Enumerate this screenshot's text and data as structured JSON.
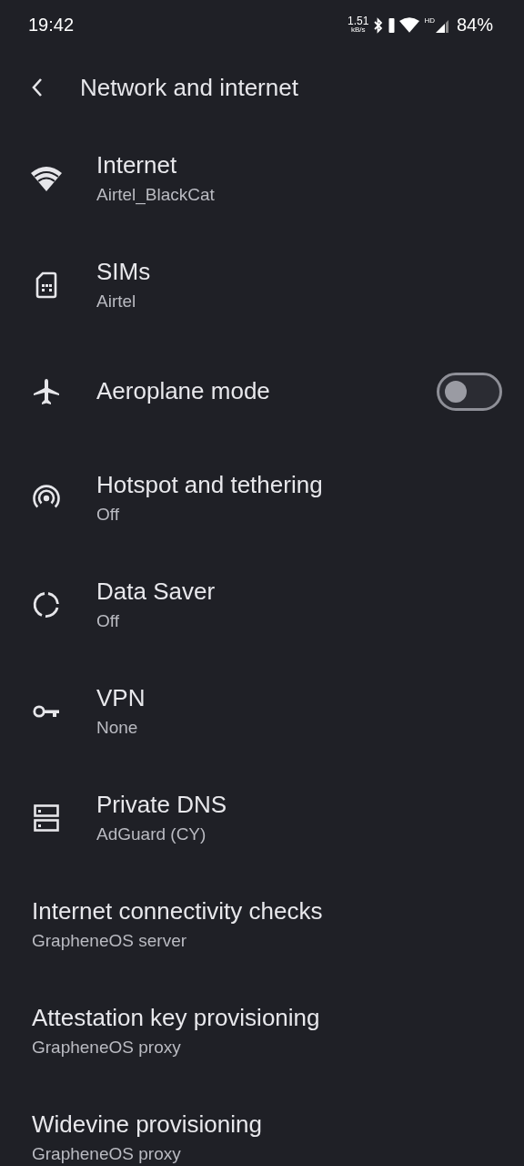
{
  "status_bar": {
    "time": "19:42",
    "speed": "1.51",
    "speed_unit": "kB/s",
    "network_type": "HD",
    "battery": "84%"
  },
  "header": {
    "title": "Network and internet"
  },
  "items": [
    {
      "kind": "icon",
      "title": "Internet",
      "subtitle": "Airtel_BlackCat"
    },
    {
      "kind": "icon",
      "title": "SIMs",
      "subtitle": "Airtel"
    },
    {
      "kind": "toggle",
      "title": "Aeroplane mode",
      "on": false
    },
    {
      "kind": "icon",
      "title": "Hotspot and tethering",
      "subtitle": "Off"
    },
    {
      "kind": "icon",
      "title": "Data Saver",
      "subtitle": "Off"
    },
    {
      "kind": "icon",
      "title": "VPN",
      "subtitle": "None"
    },
    {
      "kind": "icon",
      "title": "Private DNS",
      "subtitle": "AdGuard (CY)"
    },
    {
      "kind": "plain",
      "title": "Internet connectivity checks",
      "subtitle": "GrapheneOS server"
    },
    {
      "kind": "plain",
      "title": "Attestation key provisioning",
      "subtitle": "GrapheneOS proxy"
    },
    {
      "kind": "plain",
      "title": "Widevine provisioning",
      "subtitle": "GrapheneOS proxy"
    }
  ]
}
